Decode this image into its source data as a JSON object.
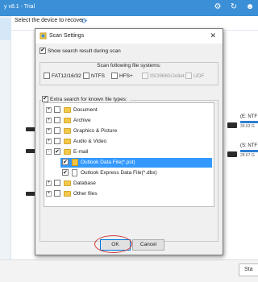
{
  "app": {
    "title": "y v8.1 - Trial",
    "select_prompt": "Select the device to recover:",
    "bottom_button": "Sta"
  },
  "drives": [
    {
      "label": "(E: NTF",
      "size": "39.63 G"
    },
    {
      "label": "(S: NTF",
      "size": "28.67 G"
    }
  ],
  "dialog": {
    "title": "Scan Settings",
    "close_glyph": "✕",
    "show_results_label": "Show search result during scan",
    "show_results_checked": true,
    "fs_group_title": "Scan following file systems:",
    "filesystems": [
      {
        "label": "FAT12/16/32",
        "checked": false,
        "enabled": true
      },
      {
        "label": "NTFS",
        "checked": false,
        "enabled": true
      },
      {
        "label": "HFS+",
        "checked": false,
        "enabled": true
      },
      {
        "label": "ISO9660/Joliet",
        "checked": false,
        "enabled": false
      },
      {
        "label": "UDF",
        "checked": false,
        "enabled": false
      }
    ],
    "extra_label": "Extra search for known file types:",
    "extra_checked": true,
    "tree": [
      {
        "label": "Document",
        "checked": false,
        "expander": "+",
        "level": 0
      },
      {
        "label": "Archive",
        "checked": false,
        "expander": "+",
        "level": 0
      },
      {
        "label": "Graphics & Picture",
        "checked": false,
        "expander": "+",
        "level": 0
      },
      {
        "label": "Audio & Video",
        "checked": false,
        "expander": "+",
        "level": 0
      },
      {
        "label": "E-mail",
        "checked": true,
        "expander": "-",
        "level": 0
      },
      {
        "label": "Outlook Data File(*.pst)",
        "checked": true,
        "expander": "",
        "level": 1,
        "selected": true
      },
      {
        "label": "Outlook Express Data File(*.dbx)",
        "checked": true,
        "expander": "",
        "level": 1
      },
      {
        "label": "Database",
        "checked": false,
        "expander": "+",
        "level": 0
      },
      {
        "label": "Other files",
        "checked": false,
        "expander": "+",
        "level": 0
      }
    ],
    "ok_label": "OK",
    "cancel_label": "Cancel"
  }
}
